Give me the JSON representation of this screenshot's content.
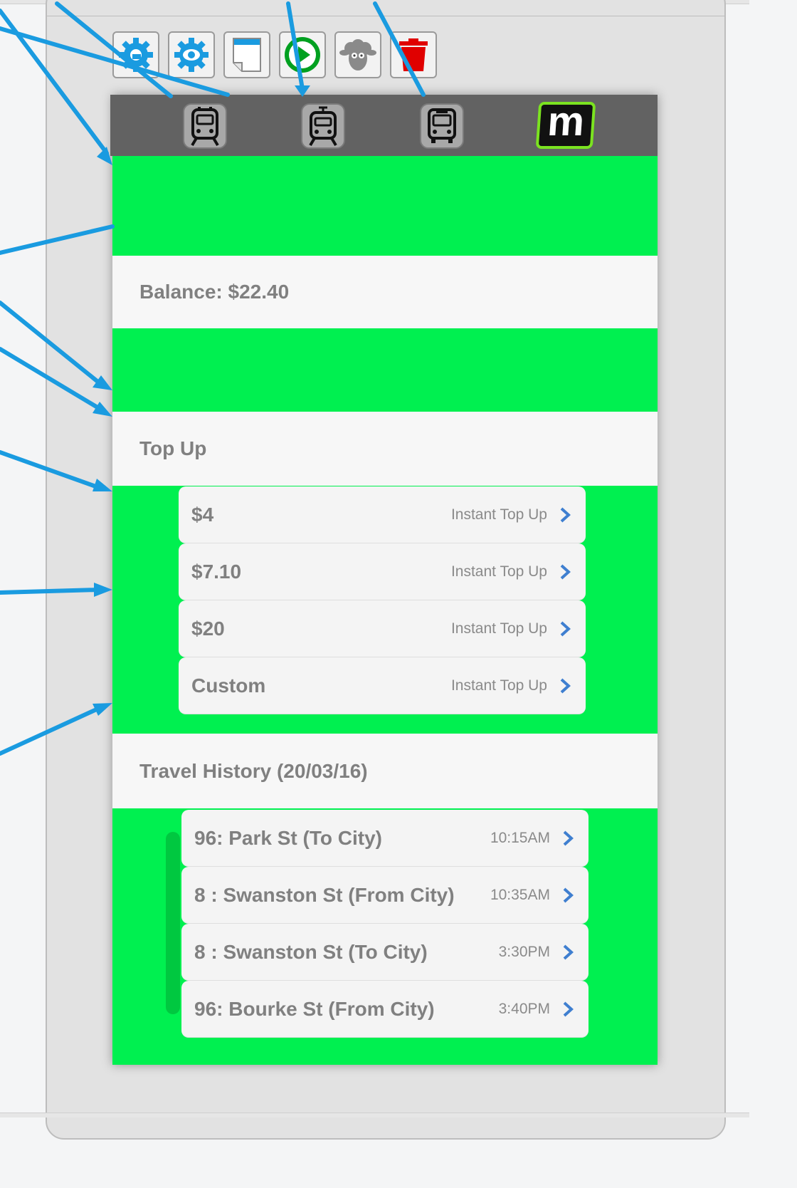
{
  "toolbar": {
    "buttons": [
      {
        "icon": "gear-edit-icon",
        "color": "#1a9be0"
      },
      {
        "icon": "gear-view-icon",
        "color": "#1a9be0"
      },
      {
        "icon": "page-icon",
        "color": "#1a9be0"
      },
      {
        "icon": "play-icon",
        "color": "#00a020"
      },
      {
        "icon": "sheep-icon",
        "color": "#808080"
      },
      {
        "icon": "trash-icon",
        "color": "#e00000"
      }
    ]
  },
  "navbar": {
    "icons": [
      "train-icon",
      "tram-icon",
      "bus-icon"
    ],
    "logo_text": "m",
    "logo_border_color": "#7be320"
  },
  "colors": {
    "accent_green": "#00f050",
    "navbar_gray": "#626262",
    "wire_blue": "#1a9be0"
  },
  "balance": {
    "label": "Balance: $22.40"
  },
  "topup": {
    "header": "Top Up",
    "items": [
      {
        "title": "$4",
        "detail": "Instant Top Up"
      },
      {
        "title": "$7.10",
        "detail": "Instant Top Up"
      },
      {
        "title": "$20",
        "detail": "Instant Top Up"
      },
      {
        "title": "Custom",
        "detail": "Instant Top Up"
      }
    ]
  },
  "history": {
    "header": "Travel History (20/03/16)",
    "items": [
      {
        "title": "96: Park St (To City)",
        "detail": "10:15AM"
      },
      {
        "title": "8 : Swanston St (From City)",
        "detail": "10:35AM"
      },
      {
        "title": "8 : Swanston St (To City)",
        "detail": "3:30PM"
      },
      {
        "title": "96: Bourke St (From City)",
        "detail": "3:40PM"
      }
    ]
  }
}
